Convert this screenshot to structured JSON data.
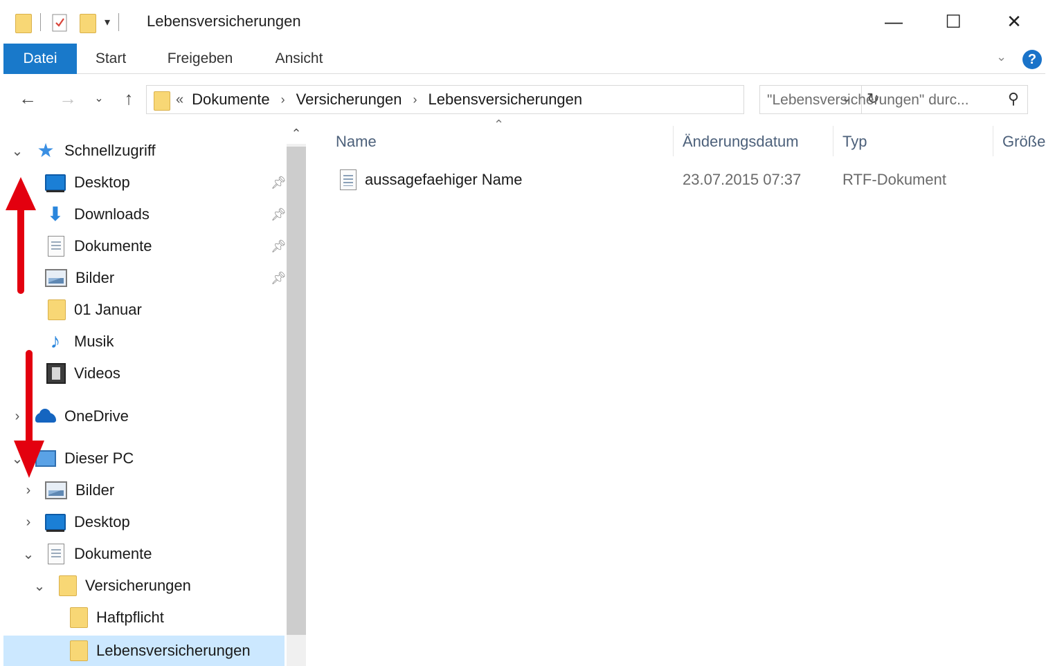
{
  "window": {
    "title": "Lebensversicherungen",
    "controls": {
      "minimize": "—",
      "maximize": "☐",
      "close": "✕"
    }
  },
  "ribbon": {
    "tabs": [
      {
        "label": "Datei",
        "active": true
      },
      {
        "label": "Start",
        "active": false
      },
      {
        "label": "Freigeben",
        "active": false
      },
      {
        "label": "Ansicht",
        "active": false
      }
    ],
    "help_icon": "?"
  },
  "address_bar": {
    "overflow": "«",
    "breadcrumbs": [
      "Dokumente",
      "Versicherungen",
      "Lebensversicherungen"
    ],
    "search_placeholder": "\"Lebensversicherungen\" durc..."
  },
  "navigation": {
    "quick_access": {
      "label": "Schnellzugriff",
      "items": [
        {
          "label": "Desktop",
          "icon": "desktop-icon",
          "pinned": true
        },
        {
          "label": "Downloads",
          "icon": "downloads-icon",
          "pinned": true
        },
        {
          "label": "Dokumente",
          "icon": "documents-icon",
          "pinned": true
        },
        {
          "label": "Bilder",
          "icon": "pictures-icon",
          "pinned": true
        },
        {
          "label": "01 Januar",
          "icon": "folder-icon",
          "pinned": false
        },
        {
          "label": "Musik",
          "icon": "music-icon",
          "pinned": false
        },
        {
          "label": "Videos",
          "icon": "videos-icon",
          "pinned": false
        }
      ]
    },
    "onedrive": {
      "label": "OneDrive"
    },
    "this_pc": {
      "label": "Dieser PC",
      "items": [
        {
          "label": "Bilder",
          "icon": "pictures-icon"
        },
        {
          "label": "Desktop",
          "icon": "desktop-icon"
        },
        {
          "label": "Dokumente",
          "icon": "documents-icon"
        },
        {
          "label": "Versicherungen",
          "icon": "folder-icon"
        },
        {
          "label": "Haftpflicht",
          "icon": "folder-icon"
        },
        {
          "label": "Lebensversicherungen",
          "icon": "folder-icon",
          "selected": true
        }
      ]
    }
  },
  "file_list": {
    "columns": [
      "Name",
      "Änderungsdatum",
      "Typ",
      "Größe"
    ],
    "rows": [
      {
        "name": "aussagefaehiger Name",
        "modified": "23.07.2015 07:37",
        "type": "RTF-Dokument",
        "size": ""
      }
    ]
  },
  "colors": {
    "accent": "#1979ca",
    "selection": "#cce8ff",
    "folder": "#f8d775",
    "annotation_arrow": "#e3000f"
  }
}
